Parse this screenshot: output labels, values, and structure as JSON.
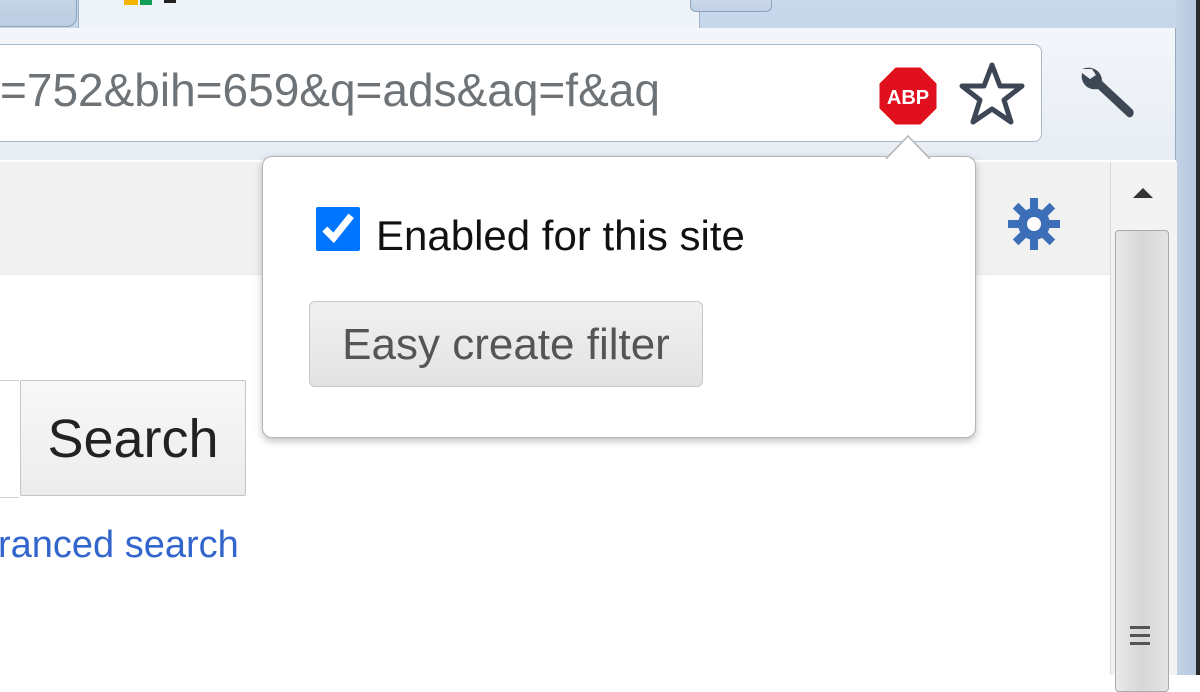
{
  "browser": {
    "url_fragment": "=752&bih=659&q=ads&aq=f&aq",
    "extension_badge": "ABP",
    "icons": {
      "extension": "adblock-plus-icon",
      "bookmark": "star-icon",
      "menu": "wrench-icon",
      "settings": "gear-icon"
    }
  },
  "popup": {
    "checkbox_label": "Enabled for this site",
    "checkbox_checked": true,
    "button_label": "Easy create filter"
  },
  "page": {
    "search_button_label": "Search",
    "advanced_search_link": "ranced search"
  },
  "colors": {
    "abp_red": "#e0101e",
    "link_blue": "#3366cc",
    "gear_blue": "#3c6fb8"
  }
}
